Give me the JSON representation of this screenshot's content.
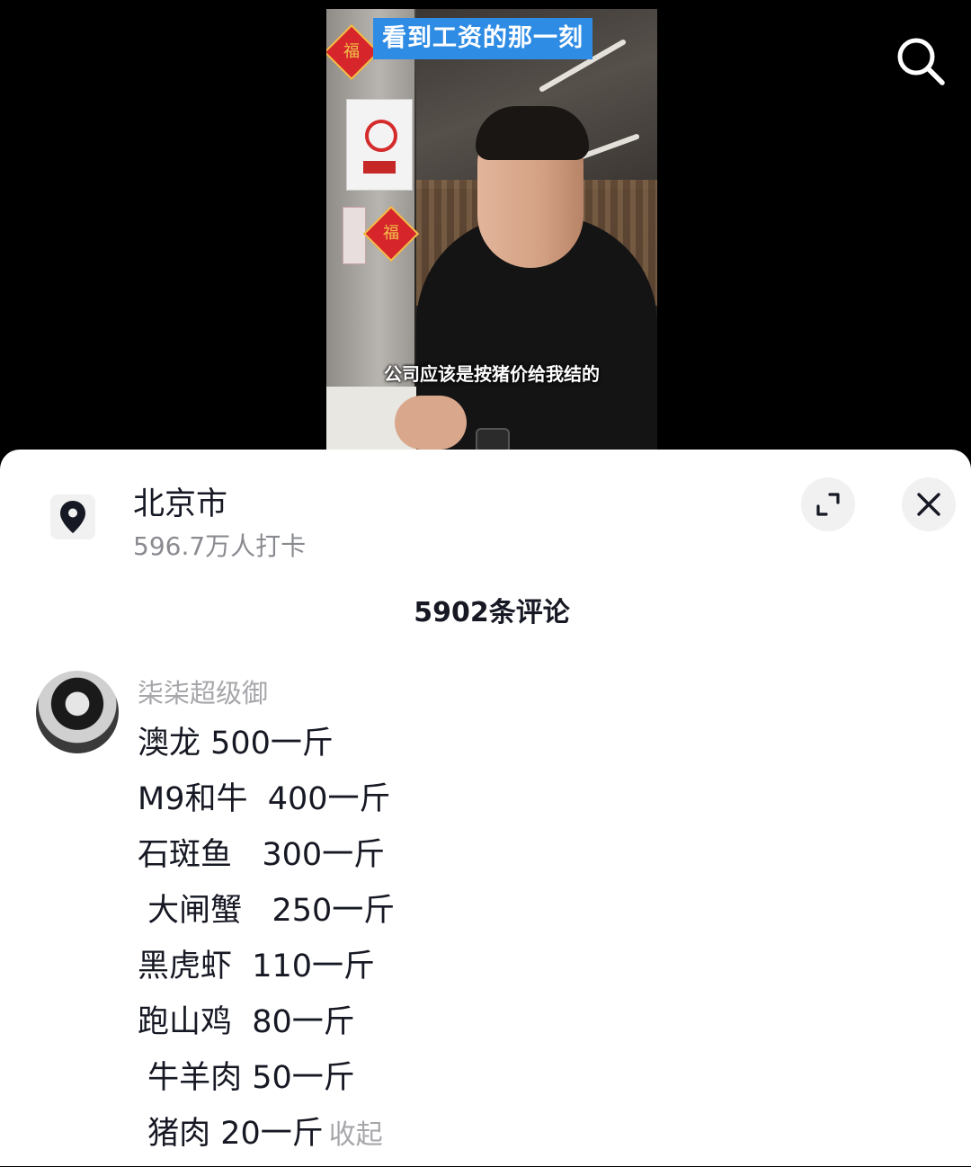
{
  "video": {
    "title_banner": "看到工资的那一刻",
    "subtitle": "公司应该是按猪价给我结的",
    "fu_char": "福"
  },
  "top_bar": {
    "search_icon": "search-icon"
  },
  "location": {
    "icon": "location-pin-icon",
    "name": "北京市",
    "checkins": "596.7万人打卡"
  },
  "sheet_controls": {
    "expand_icon": "expand-icon",
    "close_icon": "close-icon"
  },
  "comments_count": "5902条评论",
  "comment": {
    "author": "柒柒超级御",
    "lines": [
      "澳龙 500一斤",
      "M9和牛  400一斤",
      "石斑鱼   300一斤",
      " 大闸蟹   250一斤",
      "黑虎虾  110一斤",
      "跑山鸡  80一斤",
      " 牛羊肉 50一斤",
      " 猪肉 20一斤"
    ],
    "collapse_label": "收起"
  },
  "colors": {
    "banner_bg": "#2f8ce4",
    "text_primary": "#161823",
    "text_secondary": "#8a8b91",
    "text_muted": "#a7a7ab",
    "button_bg": "#f1f1f2"
  }
}
